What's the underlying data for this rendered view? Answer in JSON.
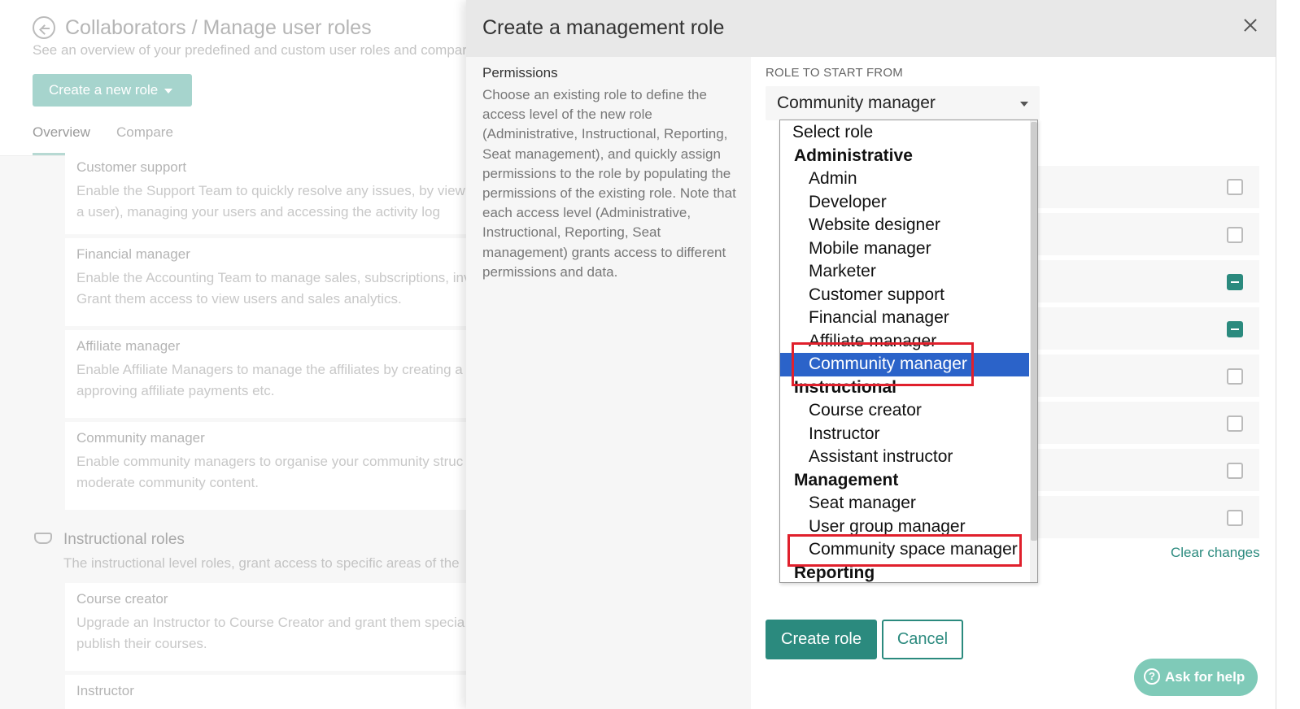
{
  "background": {
    "title": "Collaborators / Manage user roles",
    "subtitle": "See an overview of your predefined and custom user roles and compar",
    "create_button": "Create a new role",
    "tabs": [
      "Overview",
      "Compare"
    ],
    "cards": [
      {
        "title": "Customer support",
        "line1": "Enable the Support Team to quickly resolve any issues, by viewi",
        "line2": "a user), managing your users and accessing the activity log"
      },
      {
        "title": "Financial manager",
        "line1": "Enable the Accounting Team to manage sales, subscriptions, inv",
        "line2": "Grant them access to view users and sales analytics."
      },
      {
        "title": "Affiliate manager",
        "line1": "Enable Affiliate Managers to manage the affiliates by creating a",
        "line2": "approving affiliate payments etc."
      },
      {
        "title": "Community manager",
        "line1": "Enable community managers to organise your community struc",
        "line2": "moderate community content."
      }
    ],
    "section": {
      "title": "Instructional roles",
      "desc": "The instructional level roles, grant access to specific areas of the"
    },
    "cards2": [
      {
        "title": "Course creator",
        "line1": "Upgrade an Instructor to Course Creator and grant them specia",
        "line2": "publish their courses."
      },
      {
        "title": "Instructor",
        "line1": "",
        "line2": ""
      }
    ]
  },
  "modal": {
    "title": "Create a management role",
    "permissions_title": "Permissions",
    "permissions_desc": "Choose an existing role to define the access level of the new role (Administrative, Instructional, Reporting, Seat management), and quickly assign permissions to the role by populating the permissions of the existing role. Note that each access level (Administrative, Instructional, Reporting, Seat management) grants access to different permissions and data.",
    "role_label": "ROLE TO START FROM",
    "role_value": "Community manager",
    "clear_changes": "Clear changes",
    "create_button": "Create role",
    "cancel_button": "Cancel"
  },
  "dropdown": {
    "items": [
      {
        "kind": "placeholder",
        "label": "Select role"
      },
      {
        "kind": "group",
        "label": "Administrative"
      },
      {
        "kind": "opt",
        "label": "Admin"
      },
      {
        "kind": "opt",
        "label": "Developer"
      },
      {
        "kind": "opt",
        "label": "Website designer"
      },
      {
        "kind": "opt",
        "label": "Mobile manager"
      },
      {
        "kind": "opt",
        "label": "Marketer"
      },
      {
        "kind": "opt",
        "label": "Customer support"
      },
      {
        "kind": "opt",
        "label": "Financial manager"
      },
      {
        "kind": "opt",
        "label": "Affiliate manager"
      },
      {
        "kind": "opt",
        "label": "Community manager",
        "selected": true
      },
      {
        "kind": "group",
        "label": "Instructional"
      },
      {
        "kind": "opt",
        "label": "Course creator"
      },
      {
        "kind": "opt",
        "label": "Instructor"
      },
      {
        "kind": "opt",
        "label": "Assistant instructor"
      },
      {
        "kind": "group",
        "label": "Management"
      },
      {
        "kind": "opt",
        "label": "Seat manager"
      },
      {
        "kind": "opt",
        "label": "User group manager"
      },
      {
        "kind": "opt",
        "label": "Community space manager"
      },
      {
        "kind": "group",
        "label": "Reporting"
      }
    ]
  },
  "checkboxes": [
    "unchecked",
    "unchecked",
    "partial",
    "partial",
    "unchecked",
    "unchecked",
    "unchecked",
    "unchecked"
  ],
  "help": {
    "label": "Ask for help",
    "icon": "?"
  },
  "colors": {
    "accent": "#2b8a7e",
    "selected": "#2b63c9",
    "highlight": "#e0202c"
  }
}
